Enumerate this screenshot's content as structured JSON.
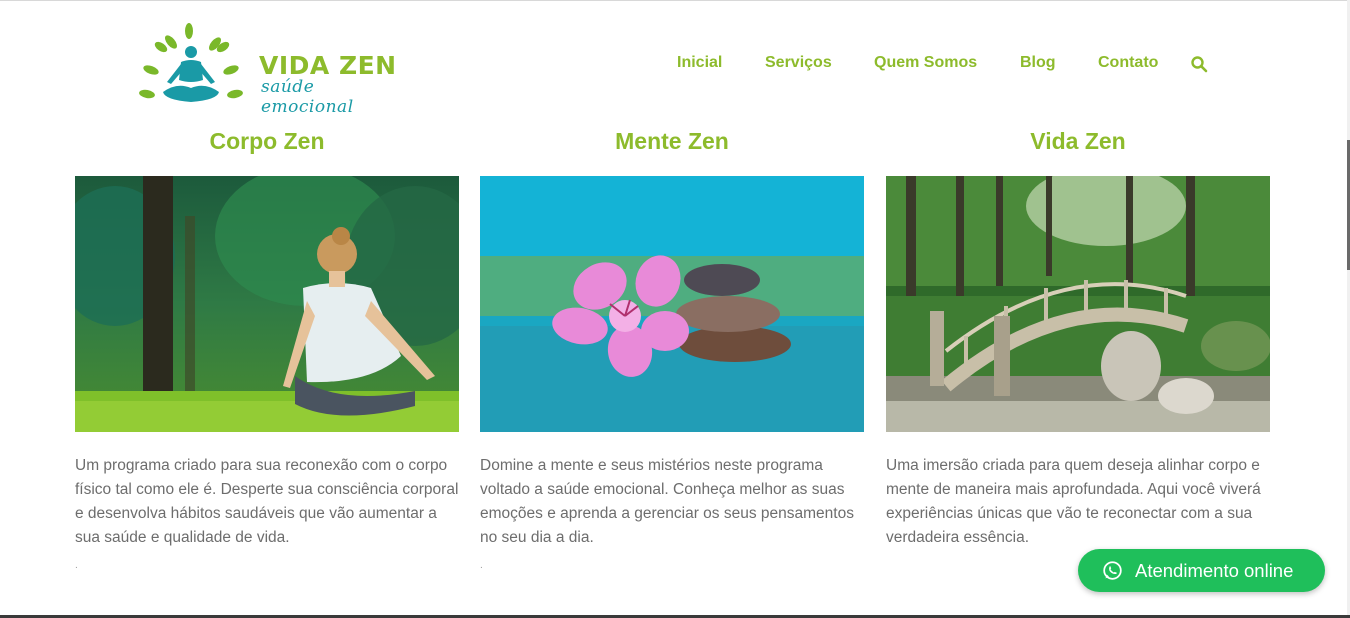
{
  "brand": {
    "title": "VIDA ZEN",
    "subtitle": "saúde emocional",
    "green": "#8dbb2c",
    "teal": "#1a9aa6"
  },
  "nav": {
    "items": [
      "Inicial",
      "Serviços",
      "Quem Somos",
      "Blog",
      "Contato"
    ],
    "search_icon": "search-icon"
  },
  "columns": [
    {
      "title": "Corpo Zen",
      "image": "woman-meditating-in-forest",
      "text": "Um programa criado para sua reconexão com o corpo físico tal como ele é. Desperte sua consciência corporal e desenvolva hábitos saudáveis que vão aumentar a sua saúde e qualidade de vida.",
      "trailing": "."
    },
    {
      "title": "Mente Zen",
      "image": "pink-flower-and-stacked-stones",
      "text": "Domine a mente e seus mistérios neste programa voltado a saúde emocional. Conheça melhor as suas emoções e aprenda a gerenciar os seus pensamentos no seu dia a dia.",
      "trailing": "."
    },
    {
      "title": "Vida Zen",
      "image": "wooden-bridge-in-japanese-garden",
      "text": "Uma imersão criada para quem deseja alinhar corpo e mente de maneira mais aprofundada. Aqui você viverá experiências únicas que vão te reconectar com a sua verdadeira essência.",
      "trailing": ""
    }
  ],
  "whatsapp": {
    "label": "Atendimento online",
    "icon": "whatsapp-icon",
    "color": "#1fbf5b"
  }
}
